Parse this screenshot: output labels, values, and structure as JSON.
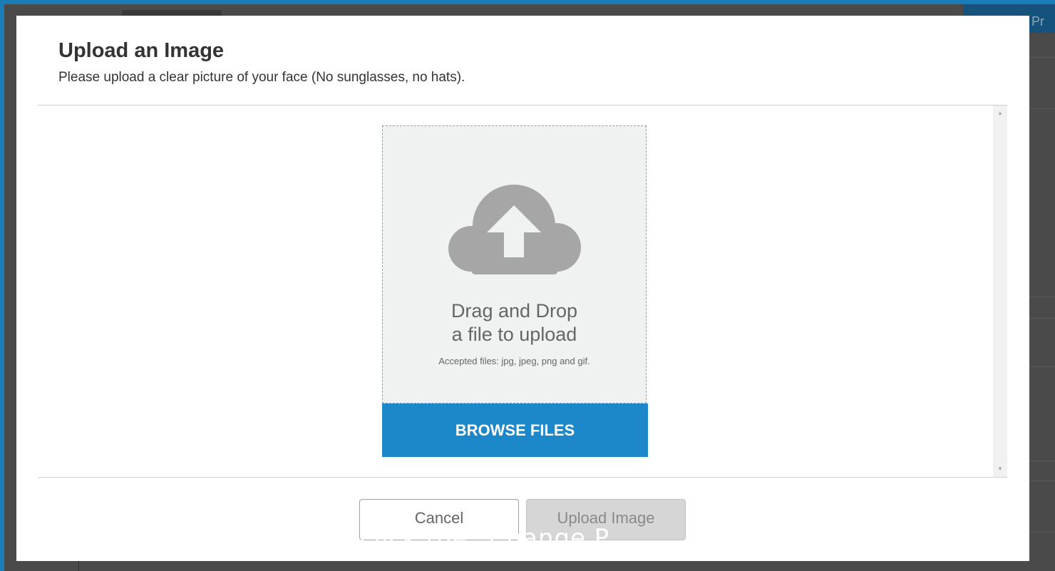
{
  "background": {
    "button_label": "Change Pr"
  },
  "modal": {
    "title": "Upload an Image",
    "subtitle": "Please upload a clear picture of your face (No sunglasses, no hats)."
  },
  "dropzone": {
    "icon": "cloud-upload-icon",
    "line1": "Drag and Drop",
    "line2": "a file to upload",
    "accepted": "Accepted files: jpg, jpeg, png and gif.",
    "browse_label": "BROWSE FILES"
  },
  "footer": {
    "cancel_label": "Cancel",
    "upload_label": "Upload Image"
  },
  "caption": {
    "text": "click the “Change P"
  },
  "colors": {
    "accent": "#1c87c9",
    "page_border": "#1a7db7",
    "icon_gray": "#a6a6a6"
  }
}
